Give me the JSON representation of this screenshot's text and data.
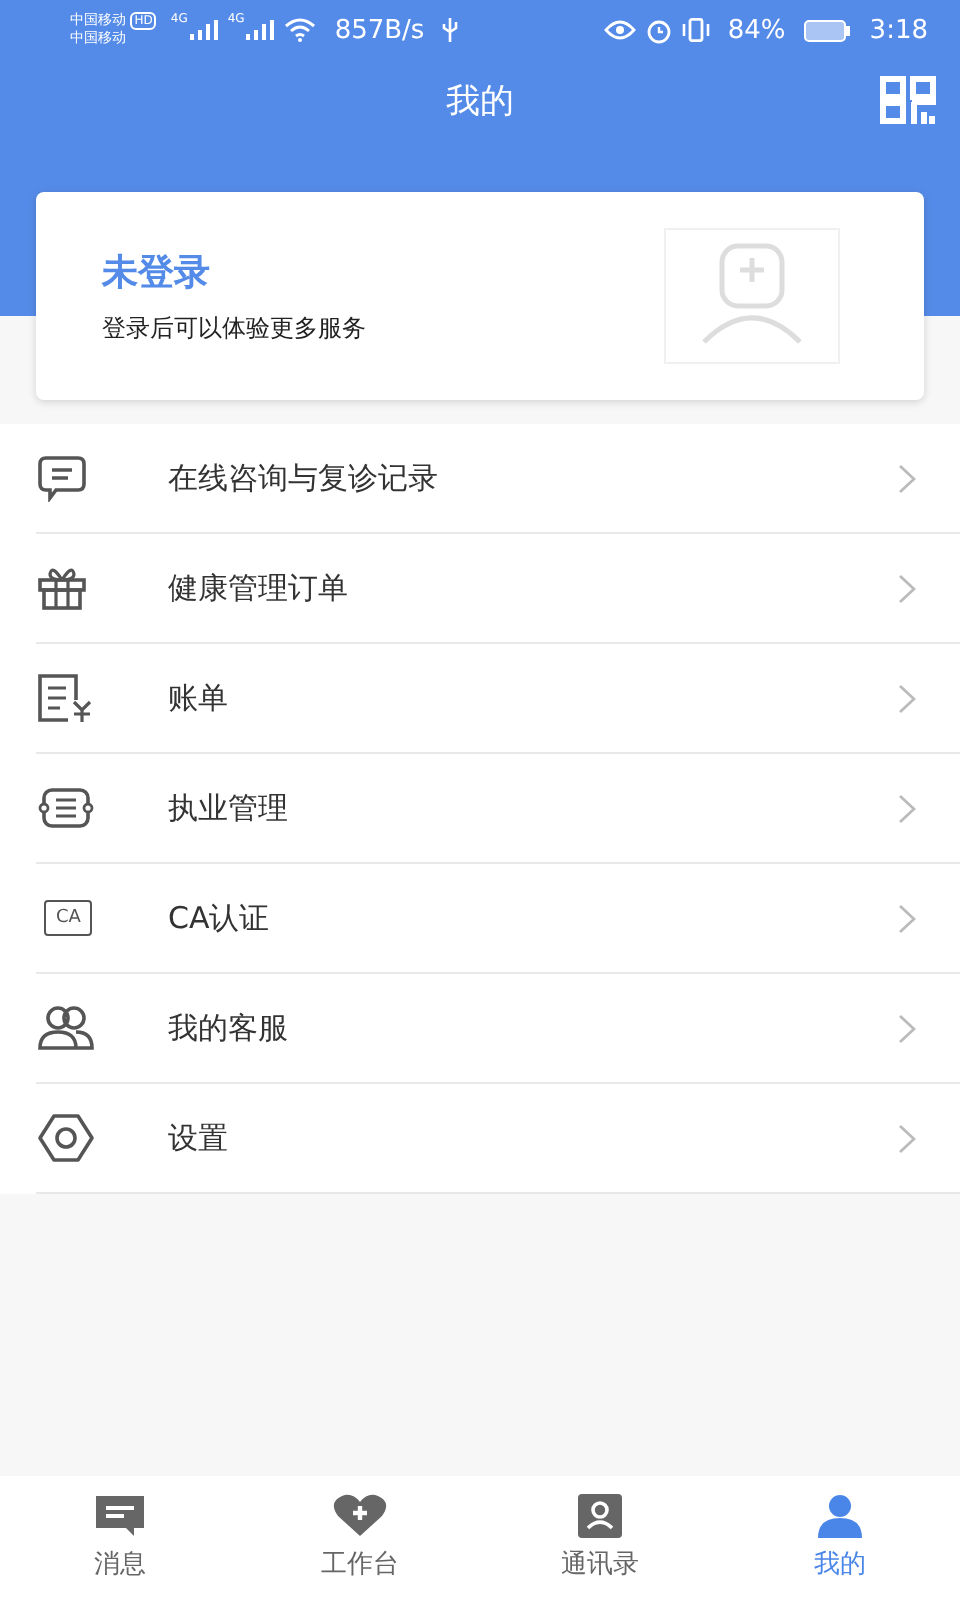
{
  "status_bar": {
    "carrier_1": "中国移动",
    "carrier_2": "中国移动",
    "hd_badge": "HD",
    "network_1": "4G",
    "network_2": "4G",
    "speed": "857B/s",
    "battery": "84%",
    "time": "3:18"
  },
  "header": {
    "title": "我的"
  },
  "profile": {
    "title": "未登录",
    "subtitle": "登录后可以体验更多服务"
  },
  "menu": [
    {
      "kind": "chat",
      "label": "在线咨询与复诊记录"
    },
    {
      "kind": "gift",
      "label": "健康管理订单"
    },
    {
      "kind": "bill",
      "label": "账单"
    },
    {
      "kind": "license",
      "label": "执业管理"
    },
    {
      "kind": "ca",
      "label": "CA认证",
      "icon_text": "CA"
    },
    {
      "kind": "people",
      "label": "我的客服"
    },
    {
      "kind": "gear",
      "label": "设置"
    }
  ],
  "tabs": [
    {
      "kind": "message",
      "label": "消息",
      "selected": false
    },
    {
      "kind": "heart",
      "label": "工作台",
      "selected": false
    },
    {
      "kind": "contact",
      "label": "通讯录",
      "selected": false
    },
    {
      "kind": "me",
      "label": "我的",
      "selected": true
    }
  ]
}
